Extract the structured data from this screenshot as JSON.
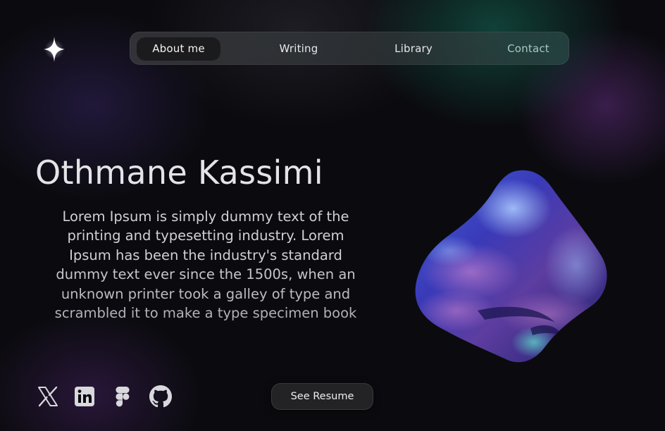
{
  "nav": {
    "items": [
      {
        "label": "About me",
        "active": true
      },
      {
        "label": "Writing",
        "active": false
      },
      {
        "label": "Library",
        "active": false
      },
      {
        "label": "Contact",
        "active": false
      }
    ]
  },
  "hero": {
    "name": "Othmane Kassimi",
    "bio": "Lorem Ipsum is simply dummy text of the printing and typesetting industry. Lorem Ipsum has been the industry's standard dummy text ever since the 1500s, when an unknown printer took a galley of type and scrambled it to make a type specimen book"
  },
  "social": [
    "x-icon",
    "linkedin-icon",
    "figma-icon",
    "github-icon"
  ],
  "cta": {
    "resume_label": "See Resume"
  },
  "colors": {
    "background": "#0b0b0f",
    "text": "#e4e4e8",
    "contact_accent": "#a6c9c3"
  }
}
